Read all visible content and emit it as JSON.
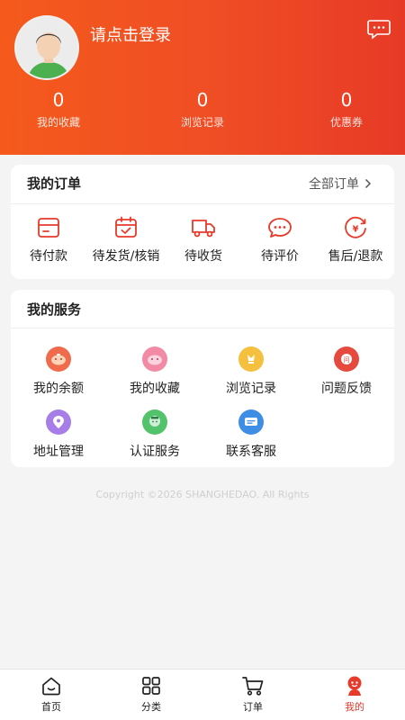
{
  "header": {
    "login_prompt": "请点击登录",
    "stats": [
      {
        "value": "0",
        "label": "我的收藏"
      },
      {
        "value": "0",
        "label": "浏览记录"
      },
      {
        "value": "0",
        "label": "优惠券"
      }
    ]
  },
  "orders": {
    "title": "我的订单",
    "all_label": "全部订单",
    "items": [
      {
        "label": "待付款",
        "icon": "wallet-icon"
      },
      {
        "label": "待发货/核销",
        "icon": "calendar-check-icon"
      },
      {
        "label": "待收货",
        "icon": "delivery-truck-icon"
      },
      {
        "label": "待评价",
        "icon": "comment-icon"
      },
      {
        "label": "售后/退款",
        "icon": "refund-icon"
      }
    ]
  },
  "services": {
    "title": "我的服务",
    "items": [
      {
        "label": "我的余额",
        "icon": "balance-icon"
      },
      {
        "label": "我的收藏",
        "icon": "favorites-icon"
      },
      {
        "label": "浏览记录",
        "icon": "history-icon"
      },
      {
        "label": "问题反馈",
        "icon": "feedback-icon"
      },
      {
        "label": "地址管理",
        "icon": "location-icon"
      },
      {
        "label": "认证服务",
        "icon": "verify-icon"
      },
      {
        "label": "联系客服",
        "icon": "customer-service-icon"
      }
    ]
  },
  "copyright": "Copyright ©2026 SHANGHEDAO. All Rights",
  "tabbar": {
    "items": [
      {
        "label": "首页",
        "icon": "home-icon"
      },
      {
        "label": "分类",
        "icon": "category-icon"
      },
      {
        "label": "订单",
        "icon": "cart-icon"
      },
      {
        "label": "我的",
        "icon": "profile-icon"
      }
    ],
    "active_index": 3
  },
  "colors": {
    "brand": "#e63a2b",
    "header_start": "#f55a1c",
    "header_end": "#e73a26"
  }
}
